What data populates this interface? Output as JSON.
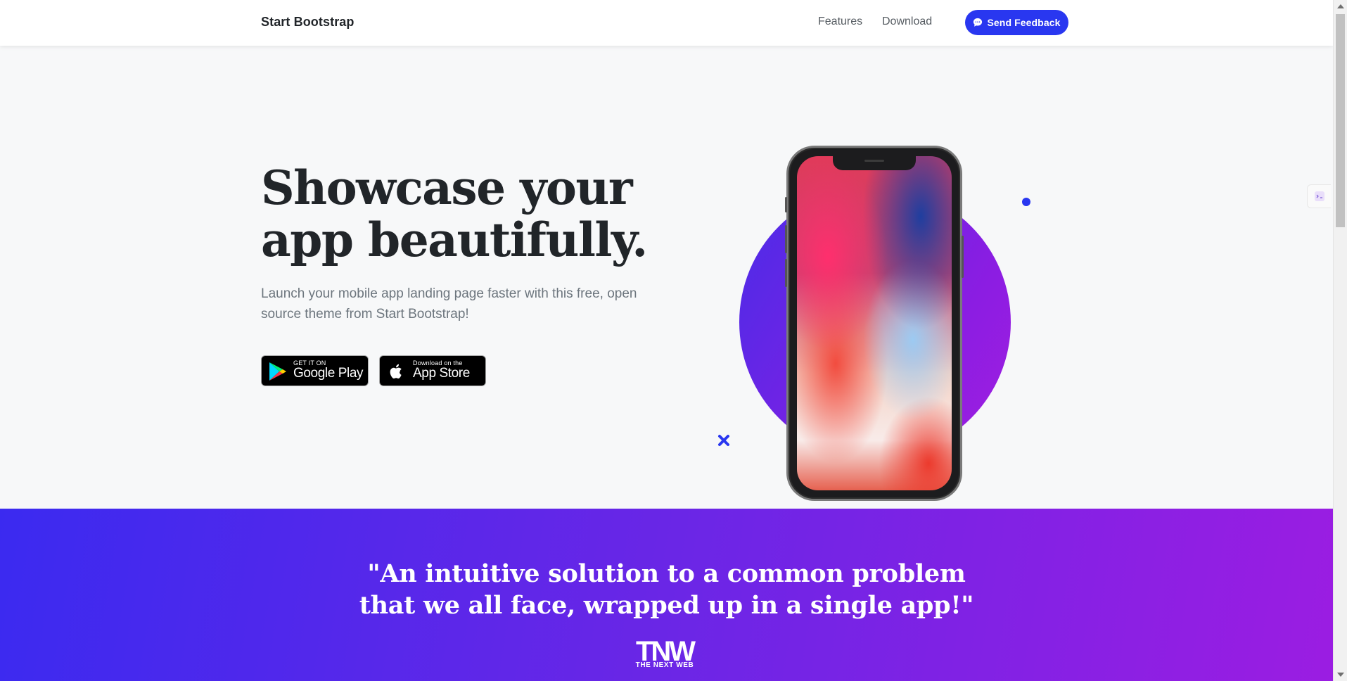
{
  "navbar": {
    "brand": "Start Bootstrap",
    "links": [
      {
        "label": "Features"
      },
      {
        "label": "Download"
      }
    ],
    "feedback_button": "Send Feedback"
  },
  "hero": {
    "title_line1": "Showcase your",
    "title_line2": "app beautifully.",
    "subtitle": "Launch your mobile app landing page faster with this free, open source theme from Start Bootstrap!",
    "google_play": {
      "small": "GET IT ON",
      "big": "Google Play"
    },
    "app_store": {
      "small": "Download on the",
      "big": "App Store"
    }
  },
  "testimonial": {
    "quote_line1": "\"An intuitive solution to a common problem",
    "quote_line2": "that we all face, wrapped up in a single app!\"",
    "logo_mark": "TNW",
    "logo_text": "THE NEXT WEB"
  },
  "colors": {
    "primary": "#2937f0",
    "gradient_start": "#3b2af0",
    "gradient_end": "#9b1de2"
  },
  "icons": {
    "feedback": "chat-bubble-icon",
    "google": "google-play-icon",
    "apple": "apple-icon",
    "extension": "extension-icon"
  }
}
